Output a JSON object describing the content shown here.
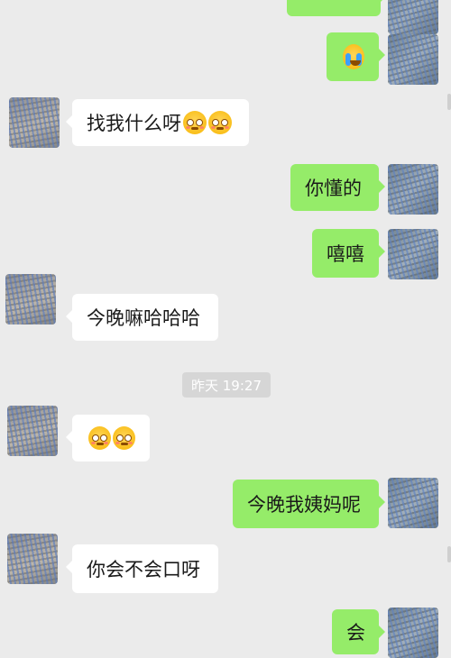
{
  "messages": [
    {
      "id": "m0",
      "side": "right",
      "text": ""
    },
    {
      "id": "m1",
      "side": "right",
      "text": ""
    },
    {
      "id": "m2",
      "side": "left",
      "text": "找我什么呀"
    },
    {
      "id": "m3",
      "side": "right",
      "text": "你懂的"
    },
    {
      "id": "m4",
      "side": "right",
      "text": "嘻嘻"
    },
    {
      "id": "m5",
      "side": "left",
      "text": "今晚嘛哈哈哈"
    },
    {
      "id": "m6",
      "side": "left",
      "text": ""
    },
    {
      "id": "m7",
      "side": "right",
      "text": "今晚我姨妈呢"
    },
    {
      "id": "m8",
      "side": "left",
      "text": "你会不会口呀"
    },
    {
      "id": "m9",
      "side": "right",
      "text": "会"
    }
  ],
  "timestamp": "昨天 19:27",
  "icons": {
    "flushed_emoji": "flushed-face-emoji-icon",
    "crying_emoji": "loudly-crying-face-emoji-icon"
  },
  "colors": {
    "background": "#ebebeb",
    "sent_bubble": "#95ec69",
    "received_bubble": "#ffffff",
    "timestamp_bg": "#d6d6d6"
  }
}
